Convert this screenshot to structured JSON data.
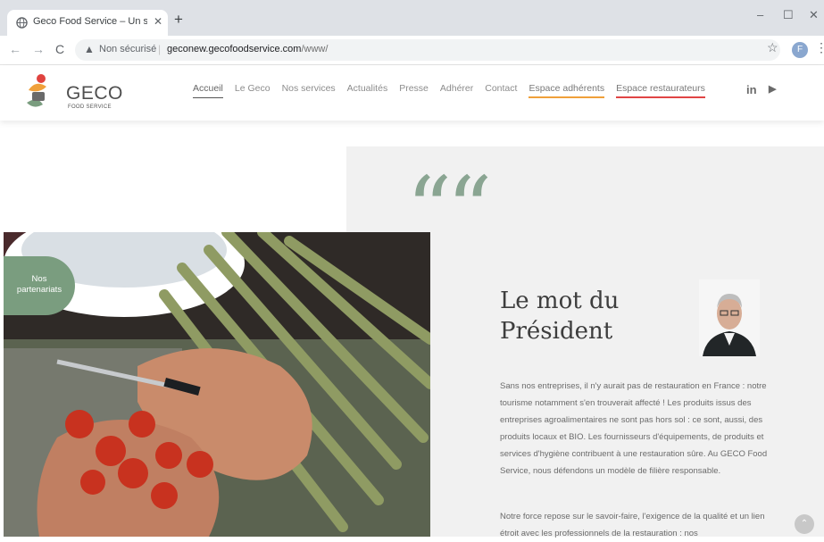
{
  "browser": {
    "tab_title": "Geco Food Service – Un site utili",
    "tab_close": "✕",
    "new_tab": "+",
    "window_controls": {
      "minimize": "–",
      "maximize": "☐",
      "close": "✕"
    },
    "nav": {
      "back": "←",
      "forward": "→",
      "reload": "C"
    },
    "security_icon": "▲",
    "security_label": "Non sécurisé",
    "separator": "|",
    "url_host": "geconew.gecofoodservice.com",
    "url_path": "/www/",
    "bookmark": "☆",
    "profile_initial": "F",
    "menu": "⋮"
  },
  "site": {
    "logo_text": "GECO",
    "logo_sub": "FOOD SERVICE",
    "nav_items": [
      "Accueil",
      "Le Geco",
      "Nos services",
      "Actualités",
      "Presse",
      "Adhérer",
      "Contact",
      "Espace adhérents",
      "Espace restaurateurs"
    ],
    "social": {
      "linkedin": "in",
      "youtube": "▶"
    }
  },
  "hero": {
    "badge_line1": "Nos",
    "badge_line2": "partenariats",
    "quote_mark": "“",
    "title_line1": "Le mot du",
    "title_line2": "Président",
    "paragraph1": "Sans nos entreprises, il n'y aurait pas de restauration en France : notre tourisme notamment s'en trouverait affecté ! Les produits issus des entreprises agroalimentaires ne sont pas hors sol : ce sont, aussi, des produits locaux et BIO. Les fournisseurs d'équipements, de produits et services d'hygiène contribuent à une restauration sûre. Au GECO Food Service, nous défendons un modèle de filière responsable.",
    "paragraph2": "Notre force repose sur le savoir-faire, l'exigence de la qualité et un lien étroit avec les professionnels de la restauration : nos",
    "scroll_top": "⌃"
  },
  "colors": {
    "accent_green": "#7a9d7f",
    "quote_green": "#8aa592",
    "nav_orange": "#f0a03a",
    "nav_red": "#e04545",
    "panel_grey": "#f1f1f1"
  }
}
